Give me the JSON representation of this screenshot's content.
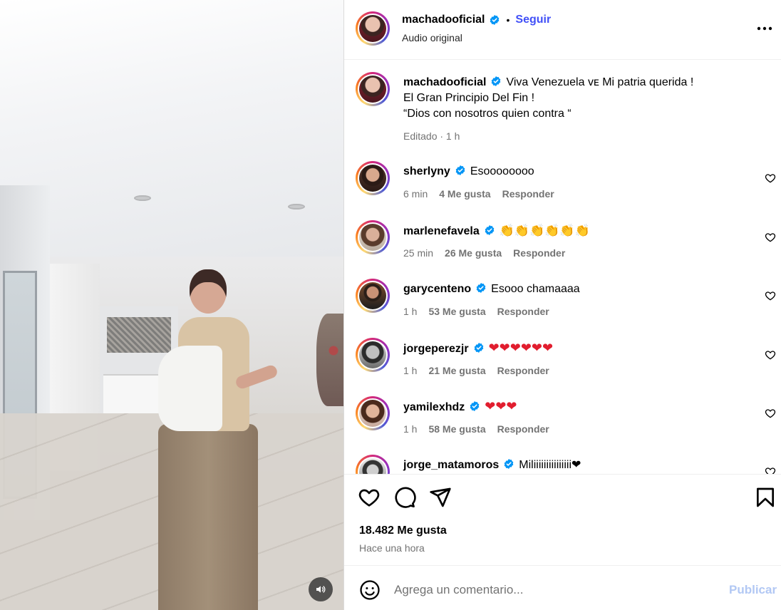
{
  "video": {
    "mute_icon": "speaker-icon"
  },
  "header": {
    "username": "machadooficial",
    "separator": "•",
    "follow_label": "Seguir",
    "subtitle": "Audio original",
    "more_icon": "more-horizontal-icon"
  },
  "caption": {
    "username": "machadooficial",
    "line1": "Viva Venezuela ᴠᴇ Mi patria querida !",
    "line2": "El Gran Principio Del Fin !",
    "line3": "“Dios con nosotros quien contra “",
    "meta": "Editado · 1 h"
  },
  "comments": [
    {
      "username": "sherlyny",
      "text": "Esoooooooo",
      "time": "6 min",
      "likes": "4 Me gusta",
      "reply": "Responder"
    },
    {
      "username": "marlenefavela",
      "text": "👏👏👏👏👏👏",
      "time": "25 min",
      "likes": "26 Me gusta",
      "reply": "Responder"
    },
    {
      "username": "garycenteno",
      "text": "Esooo chamaaaa",
      "time": "1 h",
      "likes": "53 Me gusta",
      "reply": "Responder"
    },
    {
      "username": "jorgeperezjr",
      "text": "❤❤❤❤❤❤",
      "time": "1 h",
      "likes": "21 Me gusta",
      "reply": "Responder"
    },
    {
      "username": "yamilexhdz",
      "text": "❤❤❤",
      "time": "1 h",
      "likes": "58 Me gusta",
      "reply": "Responder"
    },
    {
      "username": "jorge_matamoros",
      "text": "Miliiiiiiiiiiiiiii❤",
      "time": "",
      "likes": "",
      "reply": ""
    }
  ],
  "actions": {
    "likes": "18.482 Me gusta",
    "time": "Hace una hora"
  },
  "composer": {
    "placeholder": "Agrega un comentario...",
    "publish": "Publicar"
  },
  "colors": {
    "accent": "#4150f7",
    "verified": "#0095f6",
    "muted": "#737373",
    "publish_disabled": "#b2c8f4"
  }
}
